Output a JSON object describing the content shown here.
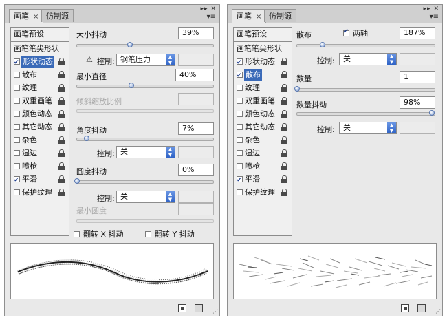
{
  "left": {
    "tabs": [
      "画笔",
      "仿制源"
    ],
    "tab_close": "×",
    "preset": "画笔预设",
    "tip_shape": "画笔笔尖形状",
    "items": [
      {
        "label": "形状动态",
        "checked": true,
        "selected": true
      },
      {
        "label": "散布",
        "checked": false,
        "selected": false
      },
      {
        "label": "纹理",
        "checked": false,
        "selected": false
      },
      {
        "label": "双重画笔",
        "checked": false,
        "selected": false
      },
      {
        "label": "颜色动态",
        "checked": false,
        "selected": false
      },
      {
        "label": "其它动态",
        "checked": false,
        "selected": false
      },
      {
        "label": "杂色",
        "checked": false,
        "selected": false
      },
      {
        "label": "湿边",
        "checked": false,
        "selected": false
      },
      {
        "label": "喷枪",
        "checked": false,
        "selected": false
      },
      {
        "label": "平滑",
        "checked": true,
        "selected": false
      },
      {
        "label": "保护纹理",
        "checked": false,
        "selected": false
      }
    ],
    "size_jitter_label": "大小抖动",
    "size_jitter_value": "39%",
    "control_label": "控制:",
    "size_control_value": "钢笔压力",
    "min_diameter_label": "最小直径",
    "min_diameter_value": "40%",
    "tilt_scale_label": "倾斜缩放比例",
    "angle_jitter_label": "角度抖动",
    "angle_jitter_value": "7%",
    "angle_control_value": "关",
    "roundness_jitter_label": "圆度抖动",
    "roundness_jitter_value": "0%",
    "roundness_control_value": "关",
    "min_roundness_label": "最小圆度",
    "flip_x_label": "翻转 X 抖动",
    "flip_y_label": "翻转 Y 抖动",
    "sliders": {
      "size_jitter": 0.39,
      "min_diameter": 0.4,
      "angle_jitter": 0.07,
      "roundness_jitter": 0.0
    }
  },
  "right": {
    "tabs": [
      "画笔",
      "仿制源"
    ],
    "tab_close": "×",
    "preset": "画笔预设",
    "tip_shape": "画笔笔尖形状",
    "items": [
      {
        "label": "形状动态",
        "checked": true,
        "selected": false
      },
      {
        "label": "散布",
        "checked": true,
        "selected": true
      },
      {
        "label": "纹理",
        "checked": false,
        "selected": false
      },
      {
        "label": "双重画笔",
        "checked": false,
        "selected": false
      },
      {
        "label": "颜色动态",
        "checked": false,
        "selected": false
      },
      {
        "label": "其它动态",
        "checked": false,
        "selected": false
      },
      {
        "label": "杂色",
        "checked": false,
        "selected": false
      },
      {
        "label": "湿边",
        "checked": false,
        "selected": false
      },
      {
        "label": "喷枪",
        "checked": false,
        "selected": false
      },
      {
        "label": "平滑",
        "checked": true,
        "selected": false
      },
      {
        "label": "保护纹理",
        "checked": false,
        "selected": false
      }
    ],
    "scatter_label": "散布",
    "both_axes_label": "两轴",
    "both_axes_checked": true,
    "scatter_value": "187%",
    "control_label": "控制:",
    "scatter_control_value": "关",
    "count_label": "数量",
    "count_value": "1",
    "count_jitter_label": "数量抖动",
    "count_jitter_value": "98%",
    "count_jitter_control_value": "关",
    "sliders": {
      "scatter": 0.187,
      "count": 0.0,
      "count_jitter": 0.98
    }
  },
  "colors": {
    "selection": "#3a6ab8",
    "panel_bg": "#e9e9e9",
    "select_arrow": "#2f63c6"
  },
  "icons": [
    "lock-icon",
    "warning-icon",
    "new-brush-icon",
    "trash-icon",
    "panel-menu-icon",
    "collapse-icon",
    "close-panel-icon",
    "dropdown-arrow-icon"
  ]
}
